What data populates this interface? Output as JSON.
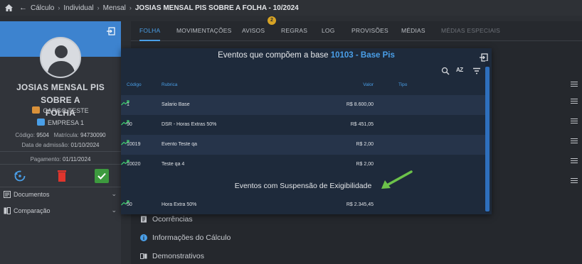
{
  "breadcrumb": {
    "items": [
      "Cálculo",
      "Individual",
      "Mensal"
    ],
    "current": "JOSIAS MENSAL PIS SOBRE A FOLHA - 10/2024"
  },
  "employee": {
    "name_line1": "JOSIAS MENSAL PIS SOBRE A",
    "name_line2": "FOLHA",
    "cargo": "CARGO TESTE",
    "empresa": "EMPRESA 1",
    "codigo_label": "Código:",
    "codigo": "9504",
    "matricula_label": "Matrícula:",
    "matricula": "94730090",
    "admissao_label": "Data de admissão:",
    "admissao": "01/10/2024",
    "pagamento_label": "Pagamento:",
    "pagamento": "01/11/2024"
  },
  "sidebar_menu": {
    "documentos": "Documentos",
    "comparacao": "Comparação"
  },
  "tabs": [
    "FOLHA",
    "MOVIMENTAÇÕES",
    "AVISOS",
    "REGRAS",
    "LOG",
    "PROVISÕES",
    "MÉDIAS",
    "MÉDIAS ESPECIAIS"
  ],
  "avisos_count": "2",
  "below_modal": {
    "ocorrencias": "Ocorrências",
    "informacoes": "Informações do Cálculo",
    "demonstrativos": "Demonstrativos"
  },
  "modal": {
    "title_prefix": "Eventos que compõem a base",
    "title_code": "10103 - Base Pis",
    "columns": {
      "codigo": "Código",
      "rubrica": "Rubrica",
      "valor": "Valor",
      "tipo": "Tipo"
    },
    "rows": [
      {
        "codigo": "1",
        "rubrica": "Salario Base",
        "valor": "R$ 8.600,00"
      },
      {
        "codigo": "90",
        "rubrica": "DSR - Horas Extras 50%",
        "valor": "R$ 451,05"
      },
      {
        "codigo": "10019",
        "rubrica": "Evento Teste qa",
        "valor": "R$ 2,00"
      },
      {
        "codigo": "10020",
        "rubrica": "Teste qa 4",
        "valor": "R$ 2,00"
      }
    ],
    "section_title": "Eventos com Suspensão de Exigibilidade",
    "suspension_rows": [
      {
        "codigo": "50",
        "rubrica": "Hora Extra 50%",
        "valor": "R$ 2.345,45"
      }
    ],
    "sort_label": "AZ"
  },
  "colors": {
    "accent": "#4a9fe8",
    "trend_green": "#3cc46b",
    "annotation_arrow": "#6cc24a",
    "banner": "#3d83cf",
    "badge": "#d7a324"
  }
}
